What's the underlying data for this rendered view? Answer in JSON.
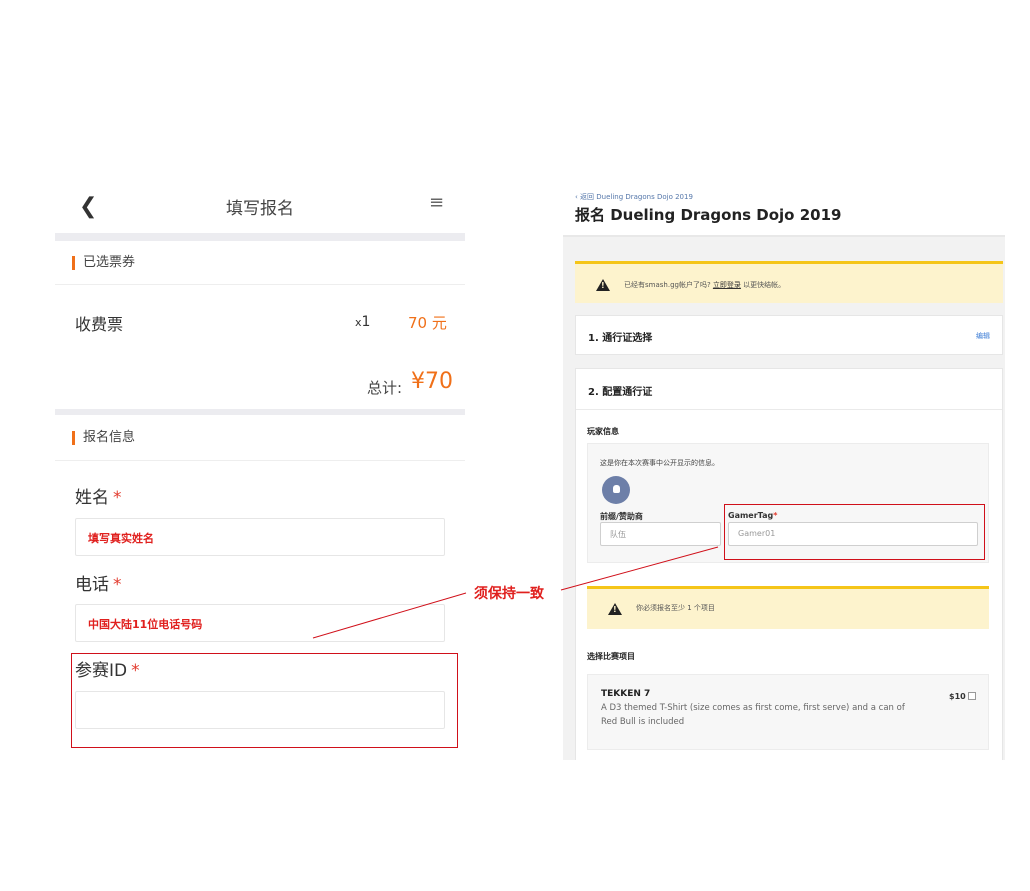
{
  "mobile": {
    "back_icon": "chevron-left-icon",
    "title": "填写报名",
    "menu_icon": "hamburger-menu-icon",
    "ticket_section": {
      "title": "已选票券",
      "ticket_name": "收费票",
      "qty_prefix": "x",
      "qty": "1",
      "price": "70 元",
      "total_label": "总计:",
      "total": "¥70"
    },
    "info_section": {
      "title": "报名信息",
      "fields": [
        {
          "label": "姓名",
          "required": "*",
          "hint": "填写真实姓名"
        },
        {
          "label": "电话",
          "required": "*",
          "hint": "中国大陆11位电话号码"
        },
        {
          "label": "参赛ID",
          "required": "*",
          "hint": ""
        }
      ]
    }
  },
  "web": {
    "breadcrumb": "‹ 返回 Dueling Dragons Dojo 2019",
    "title": "报名 Dueling Dragons Dojo 2019",
    "login_alert": {
      "prefix": "已经有smash.gg帐户了吗?",
      "link": "立即登录",
      "suffix": "以更快结帐。"
    },
    "step1": {
      "title": "1. 通行证选择",
      "edit": "编辑"
    },
    "step2": {
      "title": "2. 配置通行证"
    },
    "player_info": {
      "heading": "玩家信息",
      "description": "这是你在本次赛事中公开显示的信息。",
      "prefix_label": "前缀/赞助商",
      "prefix_placeholder": "队伍",
      "gamertag_label": "GamerTag",
      "gamertag_required": "*",
      "gamertag_placeholder": "Gamer01"
    },
    "event_alert": "你必须报名至少 1 个项目",
    "events": {
      "heading": "选择比赛项目",
      "items": [
        {
          "name": "TEKKEN 7",
          "description": "A D3 themed T-Shirt (size comes as first come, first serve) and a can of Red Bull is included",
          "price": "$10"
        }
      ]
    }
  },
  "annotation": {
    "callout": "须保持一致",
    "color": "#e0201e"
  },
  "colors": {
    "accent_orange": "#f07019",
    "required_red": "#e23b2e",
    "alert_yellow": "#fdf3cd"
  }
}
